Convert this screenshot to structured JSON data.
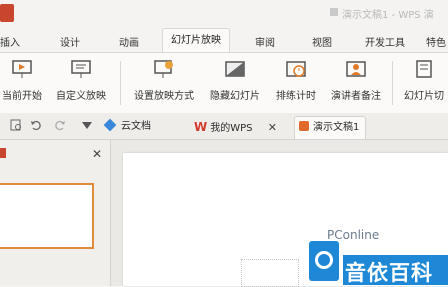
{
  "titlebar": {
    "document_title": "演示文稿1 - WPS 演"
  },
  "menu": {
    "tabs": [
      "插入",
      "设计",
      "动画",
      "幻灯片放映",
      "审阅",
      "视图",
      "开发工具",
      "特色"
    ],
    "active_tab": "幻灯片放映"
  },
  "ribbon": {
    "tools": [
      {
        "label": "当前开始",
        "icon": "play-from-current-icon"
      },
      {
        "label": "自定义放映",
        "icon": "custom-show-icon"
      },
      {
        "label": "设置放映方式",
        "icon": "show-settings-icon"
      },
      {
        "label": "隐藏幻灯片",
        "icon": "hide-slide-icon"
      },
      {
        "label": "排练计时",
        "icon": "rehearse-timing-icon"
      },
      {
        "label": "演讲者备注",
        "icon": "speaker-notes-icon"
      },
      {
        "label": "幻灯片切",
        "icon": "slide-switch-icon"
      }
    ]
  },
  "tabstrip": {
    "tabs": [
      {
        "label": "云文档",
        "icon": "cloud-doc-icon",
        "color": "#3a86d8"
      },
      {
        "label": "我的WPS",
        "icon": "wps-logo-icon",
        "color": "#d23b2f"
      },
      {
        "label": "演示文稿1",
        "icon": "presentation-icon",
        "color": "#e06a2b",
        "active": true
      }
    ]
  },
  "watermark": {
    "brand": "PConline",
    "chinese": "音依百科"
  },
  "colors": {
    "accent_orange": "#e08a3a",
    "watermark_blue": "#1e88d6"
  }
}
